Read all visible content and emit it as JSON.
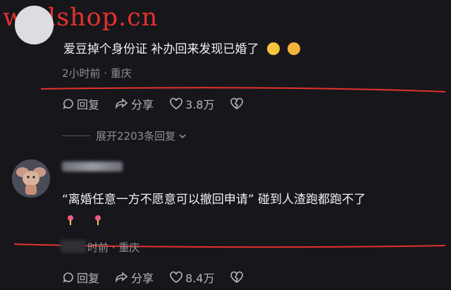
{
  "watermark": "wedshop.cn",
  "comments": [
    {
      "text": "爱豆掉个身份证 补办回来发现已婚了",
      "meta": "2小时前 · 重庆",
      "reply_label": "回复",
      "share_label": "分享",
      "likes": "3.8万",
      "emoji": [
        "face-savoring-icon",
        "rolling-laughing-icon"
      ]
    },
    {
      "text": "“离婚任意一方不愿意可以撤回申请” 碰到人渣跑都跑不了",
      "meta": "时前 · 重庆",
      "reply_label": "回复",
      "share_label": "分享",
      "likes": "8.4万",
      "emoji": [
        "pin-icon",
        "pin-icon"
      ]
    }
  ],
  "expand_replies": "展开2203条回复",
  "colors": {
    "background": "#17171b",
    "annotation": "#e5312d",
    "watermark": "#e5312d"
  }
}
